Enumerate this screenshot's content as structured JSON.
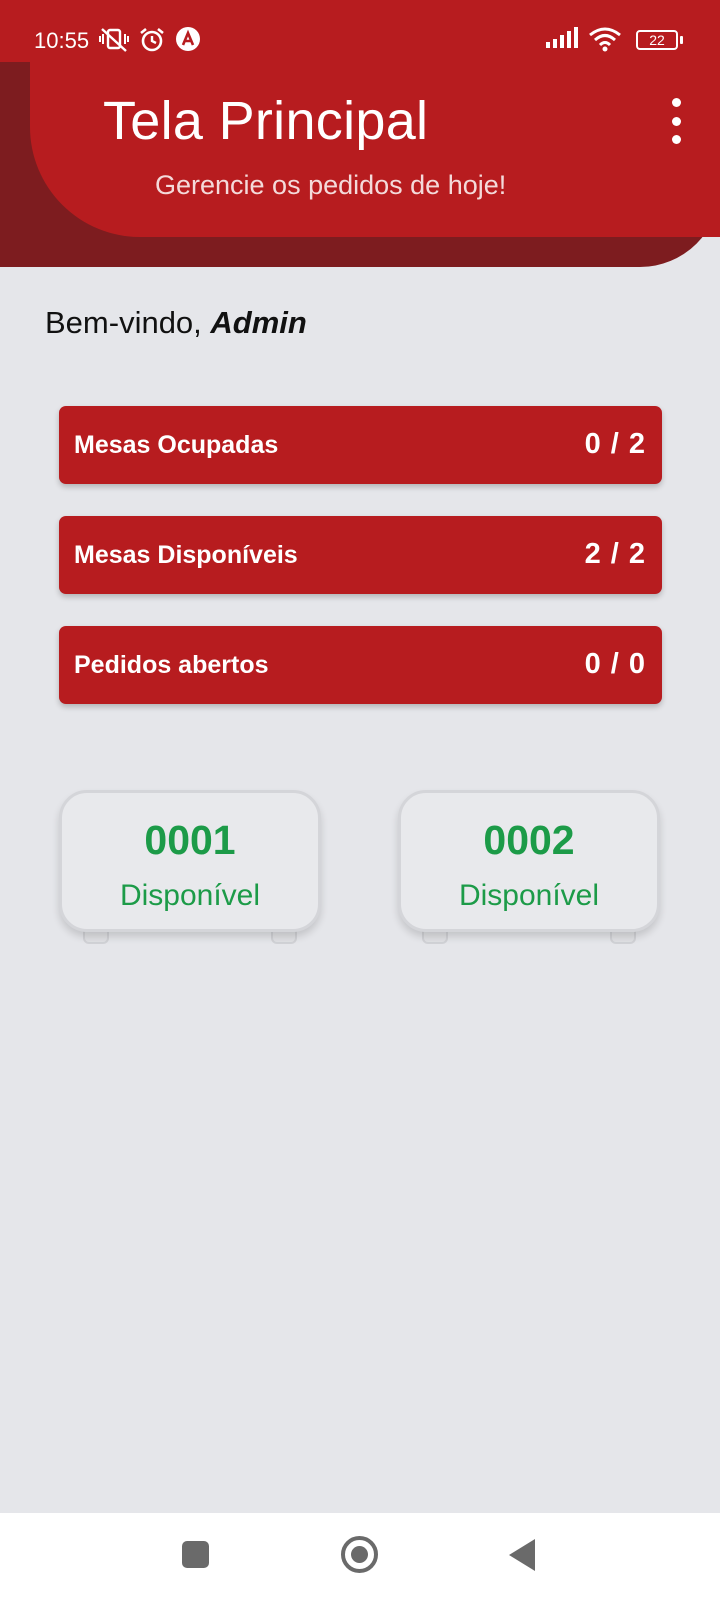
{
  "status_bar": {
    "time": "10:55",
    "battery": "22",
    "icons": [
      "vibrate-off-icon",
      "alarm-icon",
      "app-notification-icon",
      "signal-icon",
      "wifi-icon",
      "battery-icon"
    ]
  },
  "header": {
    "title": "Tela Principal",
    "subtitle": "Gerencie os pedidos de hoje!",
    "menu_icon": "more-vertical-icon"
  },
  "welcome": {
    "prefix": "Bem-vindo,",
    "user": "Admin"
  },
  "stats": [
    {
      "label": "Mesas Ocupadas",
      "value": "0 / 2"
    },
    {
      "label": "Mesas Disponíveis",
      "value": "2 / 2"
    },
    {
      "label": "Pedidos abertos",
      "value": "0 / 0"
    }
  ],
  "tables": [
    {
      "number": "0001",
      "status": "Disponível"
    },
    {
      "number": "0002",
      "status": "Disponível"
    }
  ],
  "colors": {
    "primary": "#b71c1f",
    "primary_dark": "#7d1c1f",
    "available": "#1c9b48",
    "background": "#e5e6ea"
  },
  "nav": {
    "icons": [
      "recents-square-icon",
      "home-circle-icon",
      "back-triangle-icon"
    ]
  }
}
